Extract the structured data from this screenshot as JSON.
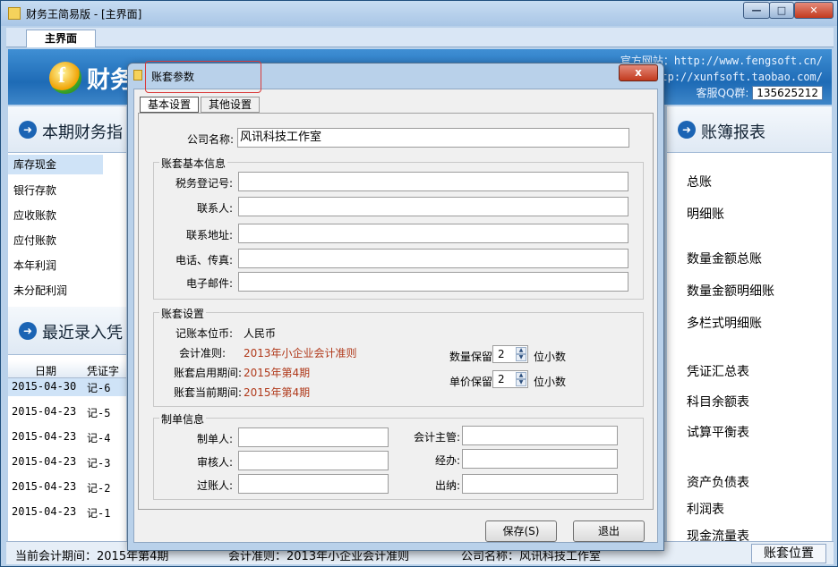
{
  "window": {
    "title": "财务王简易版 - [主界面]",
    "min_label": "—",
    "max_label": "□",
    "close_label": "✕",
    "tab": "主界面"
  },
  "banner": {
    "logo_letter": "f",
    "brand": "财务",
    "site1": "官方网站：http://www.fengsoft.cn/",
    "site2": "http://xunfsoft.taobao.com/",
    "qq_label": "客服QQ群:",
    "qq_value": "135625212"
  },
  "left": {
    "section_title": "本期财务指",
    "items": [
      "库存现金",
      "银行存款",
      "应收账款",
      "应付账款",
      "本年利润",
      "未分配利润"
    ],
    "recent_title": "最近录入凭",
    "table_headers": [
      "日期",
      "凭证字"
    ],
    "rows": [
      {
        "date": "2015-04-30",
        "no": "记-6"
      },
      {
        "date": "2015-04-23",
        "no": "记-5"
      },
      {
        "date": "2015-04-23",
        "no": "记-4"
      },
      {
        "date": "2015-04-23",
        "no": "记-3"
      },
      {
        "date": "2015-04-23",
        "no": "记-2"
      },
      {
        "date": "2015-04-23",
        "no": "记-1"
      }
    ]
  },
  "right": {
    "section_title": "账簿报表",
    "items": [
      "总账",
      "明细账",
      "数量金额总账",
      "数量金额明细账",
      "多栏式明细账",
      "凭证汇总表",
      "科目余额表",
      "试算平衡表",
      "资产负债表",
      "利润表",
      "现金流量表"
    ]
  },
  "statusbar": {
    "period": "当前会计期间：2015年第4期",
    "standard": "会计准则：2013年小企业会计准则",
    "company": "公司名称：风讯科技工作室",
    "button": "账套位置"
  },
  "dialog": {
    "title": "账套参数",
    "close_label": "x",
    "tabs": [
      "基本设置",
      "其他设置"
    ],
    "company_label": "公司名称:",
    "company_value": "风讯科技工作室",
    "basic_group": "账套基本信息",
    "tax_label": "税务登记号:",
    "contact_label": "联系人:",
    "address_label": "联系地址:",
    "phone_label": "电话、传真:",
    "email_label": "电子邮件:",
    "settings_group": "账套设置",
    "currency_label": "记账本位币:",
    "currency_value": "人民币",
    "standard_label": "会计准则:",
    "standard_value": "2013年小企业会计准则",
    "start_label": "账套启用期间:",
    "start_value": "2015年第4期",
    "current_label": "账套当前期间:",
    "current_value": "2015年第4期",
    "qty_label": "数量保留",
    "qty_value": "2",
    "qty_suffix": "位小数",
    "price_label": "单价保留",
    "price_value": "2",
    "price_suffix": "位小数",
    "maker_group": "制单信息",
    "maker_label": "制单人:",
    "auditor_label": "审核人:",
    "poster_label": "过账人:",
    "supervisor_label": "会计主管:",
    "handler_label": "经办:",
    "cashier_label": "出纳:",
    "save_button": "保存(S)",
    "exit_button": "退出"
  },
  "colors": {
    "accent": "#1b64b4",
    "highlight_box": "#d93a3a",
    "value_red": "#b0391a"
  }
}
